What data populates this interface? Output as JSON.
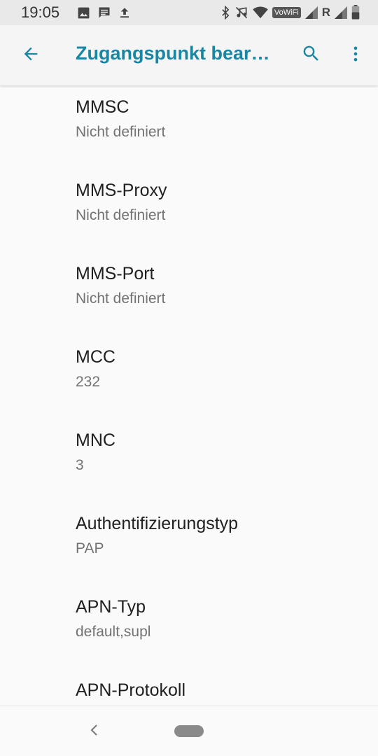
{
  "status_bar": {
    "time": "19:05",
    "left_icons": [
      "image-icon",
      "message-icon",
      "upload-icon"
    ],
    "right_icons": [
      "bluetooth-icon",
      "music-off-icon",
      "wifi-icon",
      "vowifi-badge",
      "signal-icon",
      "roaming-icon",
      "signal-icon",
      "battery-icon"
    ],
    "vowifi_label": "VoWiFi",
    "roaming_label": "R"
  },
  "app_bar": {
    "title": "Zugangspunkt bear…",
    "back_icon": "arrow-back-icon",
    "search_icon": "search-icon",
    "menu_icon": "more-vert-icon",
    "accent_color": "#1a86a1"
  },
  "settings": {
    "items": [
      {
        "title": "MMSC",
        "summary": "Nicht definiert"
      },
      {
        "title": "MMS-Proxy",
        "summary": "Nicht definiert"
      },
      {
        "title": "MMS-Port",
        "summary": "Nicht definiert"
      },
      {
        "title": "MCC",
        "summary": "232"
      },
      {
        "title": "MNC",
        "summary": "3"
      },
      {
        "title": "Authentifizierungstyp",
        "summary": "PAP"
      },
      {
        "title": "APN-Typ",
        "summary": "default,supl"
      },
      {
        "title": "APN-Protokoll",
        "summary": ""
      }
    ]
  },
  "nav_bar": {
    "back_icon": "nav-back-icon",
    "home_icon": "home-pill-icon"
  }
}
